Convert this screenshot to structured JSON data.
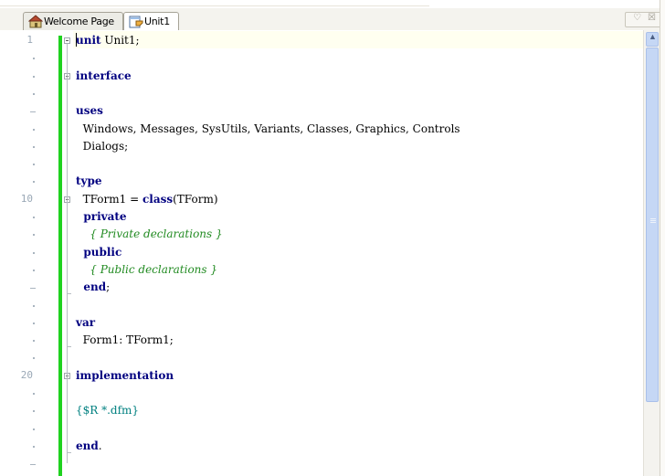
{
  "tabs": [
    {
      "label": "Welcome Page",
      "icon": "home-icon",
      "active": false
    },
    {
      "label": "Unit1",
      "icon": "unit-file-icon",
      "active": true
    }
  ],
  "window_controls": {
    "maximize": "♡",
    "close": "☒"
  },
  "editor": {
    "line_numbers": [
      {
        "line": 1,
        "label": "1"
      },
      {
        "line": 10,
        "label": "10"
      },
      {
        "line": 20,
        "label": "20"
      }
    ],
    "code_lines": [
      {
        "line": 1,
        "text": [
          {
            "t": "unit",
            "c": "kw"
          },
          {
            "t": " Unit1;",
            "c": ""
          }
        ]
      },
      {
        "line": 3,
        "text": [
          {
            "t": "interface",
            "c": "kw"
          }
        ]
      },
      {
        "line": 5,
        "text": [
          {
            "t": "uses",
            "c": "kw"
          }
        ]
      },
      {
        "line": 6,
        "text": [
          {
            "t": "  Windows, Messages, SysUtils, Variants, Classes, Graphics, Controls",
            "c": ""
          }
        ]
      },
      {
        "line": 7,
        "text": [
          {
            "t": "  Dialogs;",
            "c": ""
          }
        ]
      },
      {
        "line": 9,
        "text": [
          {
            "t": "type",
            "c": "kw"
          }
        ]
      },
      {
        "line": 10,
        "text": [
          {
            "t": "  TForm1 = ",
            "c": ""
          },
          {
            "t": "class",
            "c": "kw"
          },
          {
            "t": "(TForm)",
            "c": ""
          }
        ]
      },
      {
        "line": 11,
        "text": [
          {
            "t": "  private",
            "c": "kw"
          }
        ]
      },
      {
        "line": 12,
        "text": [
          {
            "t": "    { Private declarations }",
            "c": "cm"
          }
        ]
      },
      {
        "line": 13,
        "text": [
          {
            "t": "  public",
            "c": "kw"
          }
        ]
      },
      {
        "line": 14,
        "text": [
          {
            "t": "    { Public declarations }",
            "c": "cm"
          }
        ]
      },
      {
        "line": 15,
        "text": [
          {
            "t": "  end",
            "c": "kw"
          },
          {
            "t": ";",
            "c": ""
          }
        ]
      },
      {
        "line": 17,
        "text": [
          {
            "t": "var",
            "c": "kw"
          }
        ]
      },
      {
        "line": 18,
        "text": [
          {
            "t": "  Form1: TForm1;",
            "c": ""
          }
        ]
      },
      {
        "line": 20,
        "text": [
          {
            "t": "implementation",
            "c": "kw"
          }
        ]
      },
      {
        "line": 22,
        "text": [
          {
            "t": "{$R *.dfm}",
            "c": "dr"
          }
        ]
      },
      {
        "line": 24,
        "text": [
          {
            "t": "end",
            "c": "kw"
          },
          {
            "t": ".",
            "c": ""
          }
        ]
      }
    ]
  },
  "colors": {
    "keyword": "#000080",
    "comment": "#228b22",
    "directive": "#008080",
    "modified_bar": "#1fd21f",
    "current_line": "#fffff0"
  }
}
